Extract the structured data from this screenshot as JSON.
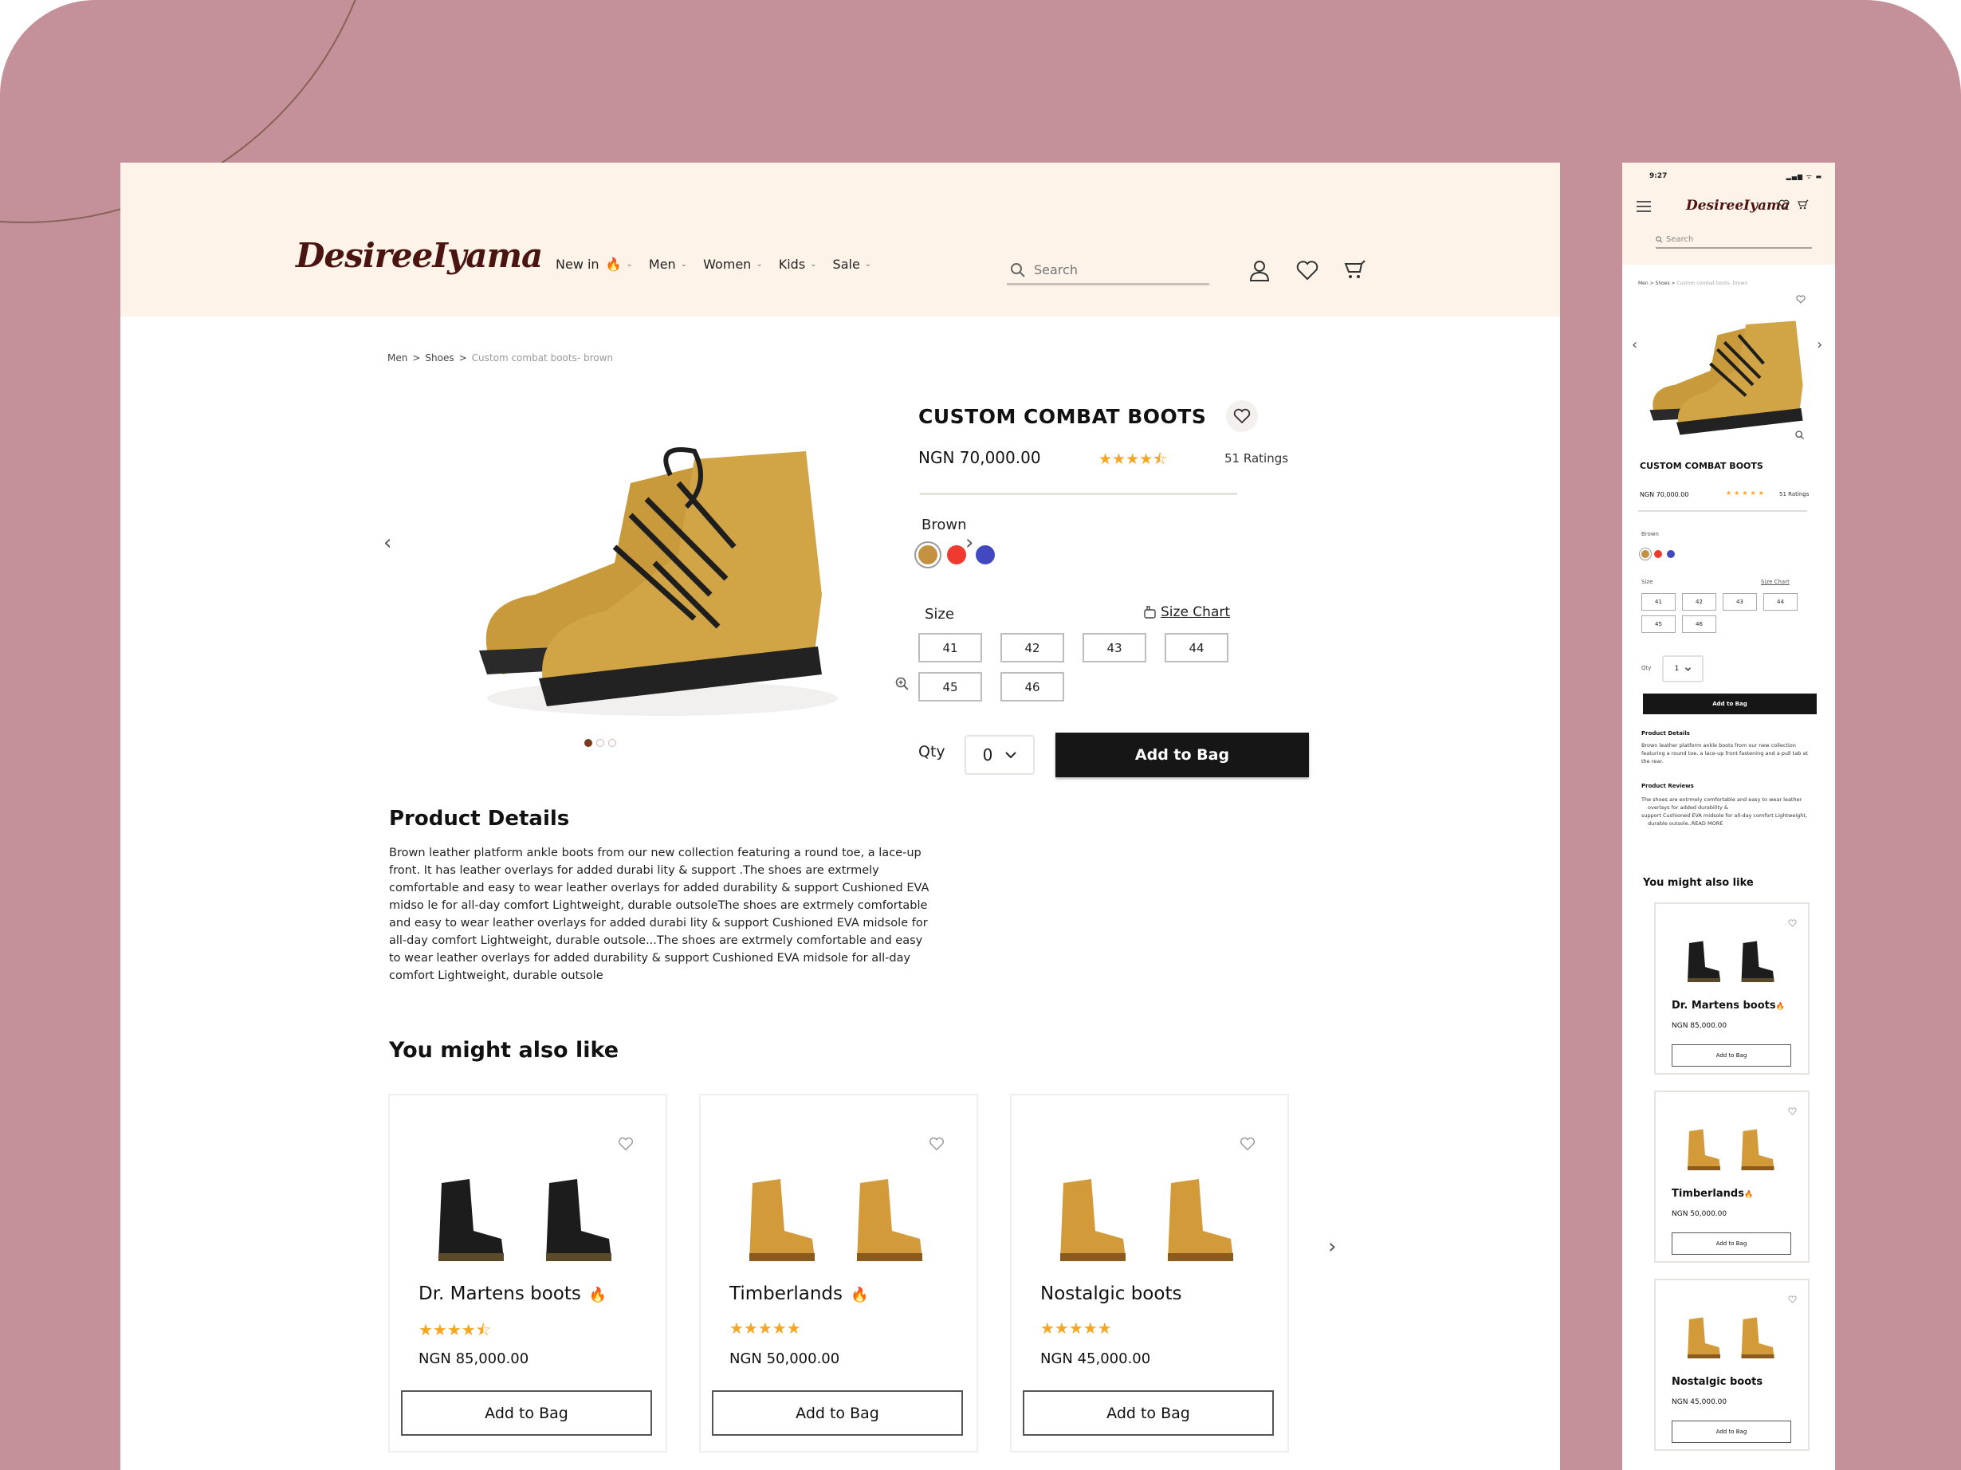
{
  "brand": {
    "logo": "DesireeIyama"
  },
  "header": {
    "nav": [
      {
        "label": "New in",
        "hot": true
      },
      {
        "label": "Men",
        "hot": false
      },
      {
        "label": "Women",
        "hot": false
      },
      {
        "label": "Kids",
        "hot": false
      },
      {
        "label": "Sale",
        "hot": false
      }
    ],
    "search_placeholder": "Search",
    "icons": [
      "user-icon",
      "heart-icon",
      "cart-icon"
    ]
  },
  "breadcrumb": {
    "items": [
      "Men",
      "Shoes"
    ],
    "current": "Custom combat boots- brown",
    "separator": ">"
  },
  "gallery": {
    "slides": 3,
    "active_slide": 1
  },
  "product": {
    "title": "CUSTOM COMBAT BOOTS",
    "price": "NGN  70,000.00",
    "rating": 4.5,
    "ratings_label": "51 Ratings",
    "color_label": "Brown",
    "colors": [
      {
        "name": "Brown",
        "hex": "#c49140",
        "selected": true
      },
      {
        "name": "Red",
        "hex": "#f03a30",
        "selected": false
      },
      {
        "name": "Blue",
        "hex": "#4148c0",
        "selected": false
      }
    ],
    "size_label": "Size",
    "size_chart_label": "Size Chart",
    "sizes": [
      "41",
      "42",
      "43",
      "44",
      "45",
      "46"
    ],
    "qty_label": "Qty",
    "qty_value": "0",
    "add_to_bag": "Add to Bag"
  },
  "details": {
    "title": "Product Details",
    "text": "Brown leather platform ankle boots from our new collection featuring a round toe, a lace-up front. It has leather overlays for added durabi lity & support .The shoes are extrmely comfortable and easy to wear  leather overlays for added durability & support Cushioned EVA midso le for all-day comfort Lightweight, durable outsoleThe shoes are extrmely comfortable and easy to wear  leather overlays for added durabi lity & support Cushioned EVA midsole for all-day comfort Lightweight, durable outsole...The shoes are extrmely comfortable and easy to wear  leather overlays for added durability & support Cushioned EVA midsole for all-day comfort Lightweight, durable outsole"
  },
  "recommendations": {
    "title": "You might also like",
    "items": [
      {
        "name": "Dr. Martens boots",
        "hot": true,
        "rating": 4.5,
        "price": "NGN  85,000.00",
        "button": "Add to Bag",
        "color": "black"
      },
      {
        "name": "Timberlands",
        "hot": true,
        "rating": 5,
        "price": "NGN  50,000.00",
        "button": "Add to Bag",
        "color": "tan"
      },
      {
        "name": "Nostalgic boots",
        "hot": false,
        "rating": 5,
        "price": "NGN  45,000.00",
        "button": "Add to Bag",
        "color": "tan"
      }
    ]
  },
  "mobile": {
    "time": "9:27",
    "status": "▂▄▆ ᯤ ▬",
    "logo": "DesireeIyama",
    "search_placeholder": "Search",
    "breadcrumb": "Men > Shoes >",
    "breadcrumb_current": "Custom combat boots- brown",
    "title": "CUSTOM COMBAT BOOTS",
    "price": "NGN  70,000.00",
    "ratings_label": "51 Ratings",
    "color_label": "Brown",
    "size_label": "Size",
    "size_chart_label": "Size Chart",
    "qty_label": "Qty",
    "qty_value": "1",
    "add_to_bag": "Add to Bag",
    "details_title": "Product Details",
    "details_text": "Brown leather platform ankle boots from our new collection featuring a round toe, a lace-up front fastening and a pull tab at the rear.",
    "reviews_title": "Product Reviews",
    "reviews": [
      "The shoes are extrmely comfortable and easy to wear  leather overlays for added durability &",
      "support Cushioned EVA midsole for all-day comfort Lightweight, durable outsole..READ MORE"
    ],
    "recommend_title": "You might also like"
  }
}
